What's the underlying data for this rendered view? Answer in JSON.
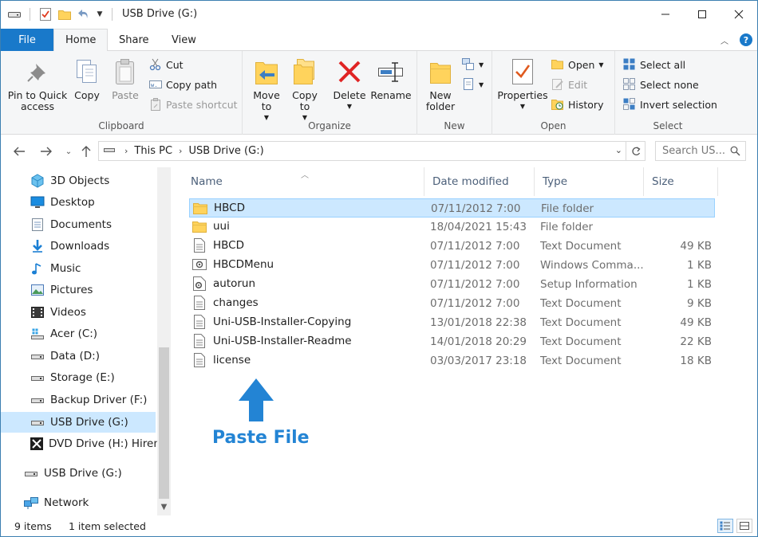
{
  "window": {
    "title": "USB Drive (G:)"
  },
  "ribbon_tabs": {
    "file": "File",
    "home": "Home",
    "share": "Share",
    "view": "View"
  },
  "ribbon": {
    "clipboard": {
      "label": "Clipboard",
      "pin": "Pin to Quick access",
      "copy": "Copy",
      "paste": "Paste",
      "cut": "Cut",
      "copy_path": "Copy path",
      "paste_shortcut": "Paste shortcut"
    },
    "organize": {
      "label": "Organize",
      "move_to": "Move to",
      "copy_to": "Copy to",
      "delete": "Delete",
      "rename": "Rename"
    },
    "new": {
      "label": "New",
      "new_folder": "New folder"
    },
    "open": {
      "label": "Open",
      "properties": "Properties",
      "open": "Open",
      "edit": "Edit",
      "history": "History"
    },
    "select": {
      "label": "Select",
      "select_all": "Select all",
      "select_none": "Select none",
      "invert": "Invert selection"
    }
  },
  "address": {
    "crumbs": [
      "This PC",
      "USB Drive (G:)"
    ],
    "search_placeholder": "Search US..."
  },
  "nav_items": [
    {
      "label": "3D Objects",
      "icon": "3d-objects-icon"
    },
    {
      "label": "Desktop",
      "icon": "desktop-icon"
    },
    {
      "label": "Documents",
      "icon": "documents-icon"
    },
    {
      "label": "Downloads",
      "icon": "downloads-icon"
    },
    {
      "label": "Music",
      "icon": "music-icon"
    },
    {
      "label": "Pictures",
      "icon": "pictures-icon"
    },
    {
      "label": "Videos",
      "icon": "videos-icon"
    },
    {
      "label": "Acer (C:)",
      "icon": "system-drive-icon"
    },
    {
      "label": "Data (D:)",
      "icon": "drive-icon"
    },
    {
      "label": "Storage (E:)",
      "icon": "drive-icon"
    },
    {
      "label": "Backup Driver (F:)",
      "icon": "drive-icon"
    },
    {
      "label": "USB Drive (G:)",
      "icon": "usb-drive-icon"
    },
    {
      "label": "DVD Drive (H:) Hiren's",
      "icon": "dvd-drive-icon"
    },
    {
      "label": "USB Drive (G:)",
      "icon": "usb-drive-icon"
    },
    {
      "label": "Network",
      "icon": "network-icon"
    }
  ],
  "columns": {
    "name": "Name",
    "date": "Date modified",
    "type": "Type",
    "size": "Size"
  },
  "files": [
    {
      "name": "HBCD",
      "date": "07/11/2012 7:00",
      "type": "File folder",
      "size": "",
      "icon": "folder-icon"
    },
    {
      "name": "uui",
      "date": "18/04/2021 15:43",
      "type": "File folder",
      "size": "",
      "icon": "folder-icon"
    },
    {
      "name": "HBCD",
      "date": "07/11/2012 7:00",
      "type": "Text Document",
      "size": "49 KB",
      "icon": "text-document-icon"
    },
    {
      "name": "HBCDMenu",
      "date": "07/11/2012 7:00",
      "type": "Windows Comma...",
      "size": "1 KB",
      "icon": "command-script-icon"
    },
    {
      "name": "autorun",
      "date": "07/11/2012 7:00",
      "type": "Setup Information",
      "size": "1 KB",
      "icon": "setup-info-icon"
    },
    {
      "name": "changes",
      "date": "07/11/2012 7:00",
      "type": "Text Document",
      "size": "9 KB",
      "icon": "text-document-icon"
    },
    {
      "name": "Uni-USB-Installer-Copying",
      "date": "13/01/2018 22:38",
      "type": "Text Document",
      "size": "49 KB",
      "icon": "text-document-icon"
    },
    {
      "name": "Uni-USB-Installer-Readme",
      "date": "14/01/2018 20:29",
      "type": "Text Document",
      "size": "22 KB",
      "icon": "text-document-icon"
    },
    {
      "name": "license",
      "date": "03/03/2017 23:18",
      "type": "Text Document",
      "size": "18 KB",
      "icon": "text-document-icon"
    }
  ],
  "annotation": {
    "label": "Paste File"
  },
  "status": {
    "count": "9 items",
    "selection": "1 item selected"
  },
  "colors": {
    "accent": "#1979ca",
    "selection": "#cce8ff",
    "annotation": "#2384d4"
  }
}
